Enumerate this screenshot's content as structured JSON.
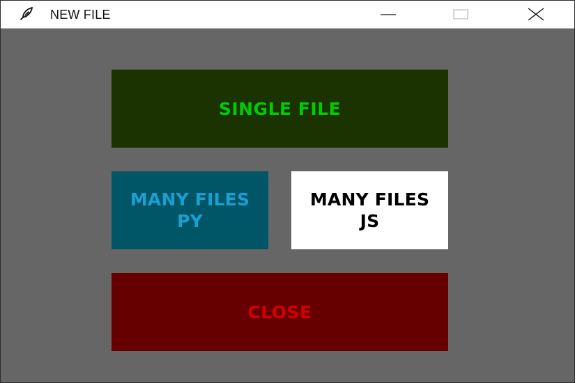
{
  "window": {
    "title": "NEW FILE"
  },
  "icons": {
    "app": "feather-icon",
    "minimize": "minimize-icon",
    "maximize": "maximize-icon",
    "close": "close-icon"
  },
  "buttons": {
    "single_file": "SINGLE FILE",
    "many_files_py": "MANY FILES\nPY",
    "many_files_js": "MANY FILES\nJS",
    "close": "CLOSE"
  },
  "colors": {
    "background": "#666666",
    "single_file_bg": "#1a3300",
    "single_file_text": "#00cc00",
    "many_py_bg": "#005566",
    "many_py_text": "#1a9fd1",
    "many_js_bg": "#ffffff",
    "many_js_text": "#000000",
    "close_bg": "#660000",
    "close_text": "#d40000"
  }
}
